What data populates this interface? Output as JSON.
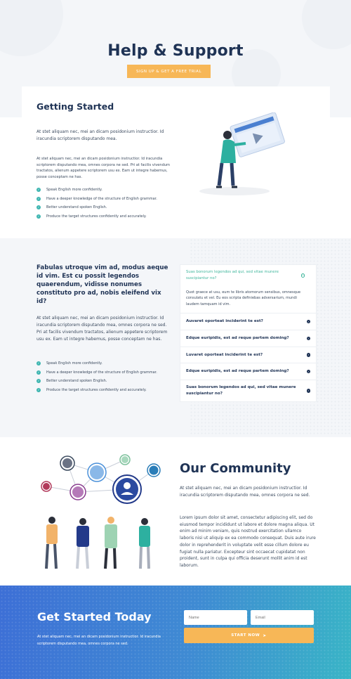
{
  "hero": {
    "title": "Help & Support",
    "cta_label": "SIGN UP & GET A FREE TRIAL"
  },
  "getting_started": {
    "title": "Getting Started",
    "intro": "At stet aliquam nec, mei an dicam posidonium instructior. Id iracundia scriptorem disputando mea.",
    "body": "At stet aliquam nec, mei an dicam posidonium instructior. Id iracundia scriptorem disputando mea, omnes corpora ne sed. Pri at facilis vivendum tractatos, alienum appetere scriptorem usu ex. Eam ut integre habemus, posse conceptam ne has.",
    "checklist": [
      "Speak English more confidently.",
      "Have a deeper knowledge of the structure of English grammar.",
      "Better understand spoken English.",
      "Produce the target structures confidently and accurately."
    ]
  },
  "faq_section": {
    "heading": "Fabulas utroque vim ad, modus aeque id vim. Est cu possit legendos quaerendum, vidisse nonumes constituto pro ad, nobis eleifend vix id?",
    "body": "At stet aliquam nec, mei an dicam posidonium instructior. Id iracundia scriptorem disputando mea, omnes corpora ne sed. Pri at facilis vivendum tractatos, alienum appetere scriptorem usu ex. Eam ut integre habemus, posse conceptam ne has.",
    "checklist": [
      "Speak English more confidently.",
      "Have a deeper knowledge of the structure of English grammar.",
      "Better understand spoken English.",
      "Produce the target structures confidently and accurately."
    ],
    "open_item": {
      "question": "Suas bonorum legendos ad qui, sed vitae munere suscipiantur no?",
      "answer": "Quot graece at usu, eum te libris atomorum sensibus, omnesque consulatu et vel. Eu eos scripta definiebas adversarium, mundi laudem tamquam id vim."
    },
    "items": [
      "Auvaret oporteat inciderint te est?",
      "Edque euripidis, est ad reque partem doming?",
      "Luvaret oporteat inciderint te est?",
      "Edque euripidis, est ad reque partem doming?",
      "Suas bonorum legendos ad qui, sed vitae munere suscipiantur no?"
    ]
  },
  "community": {
    "title": "Our Community",
    "intro": "At stet aliquam nec, mei an dicam posidonium instructior. Id iracundia scriptorem disputando mea, omnes corpora ne sed.",
    "body": "Lorem ipsum dolor sit amet, consectetur adipiscing elit, sed do eiusmod tempor incididunt ut labore et dolore magna aliqua. Ut enim ad minim veniam, quis nostrud exercitation ullamco laboris nisi ut aliquip ex ea commodo consequat. Duis aute irure dolor in reprehenderit in voluptate velit esse cillum dolore eu fugiat nulla pariatur. Excepteur sint occaecat cupidatat non proident, sunt in culpa qui officia deserunt mollit anim id est laborum."
  },
  "cta": {
    "title": "Get Started Today",
    "text": "At stet aliquam nec, mei an dicam posidonium instructior. Id iracundia scriptorem disputando mea, omnes corpora ne sed.",
    "name_placeholder": "Name",
    "email_placeholder": "Email",
    "button_label": "START NOW"
  },
  "colors": {
    "navy": "#1f3355",
    "accent_orange": "#f7b757",
    "teal": "#3db5b0",
    "blue_start": "#3d6fd6",
    "teal_end": "#39b5c6"
  }
}
